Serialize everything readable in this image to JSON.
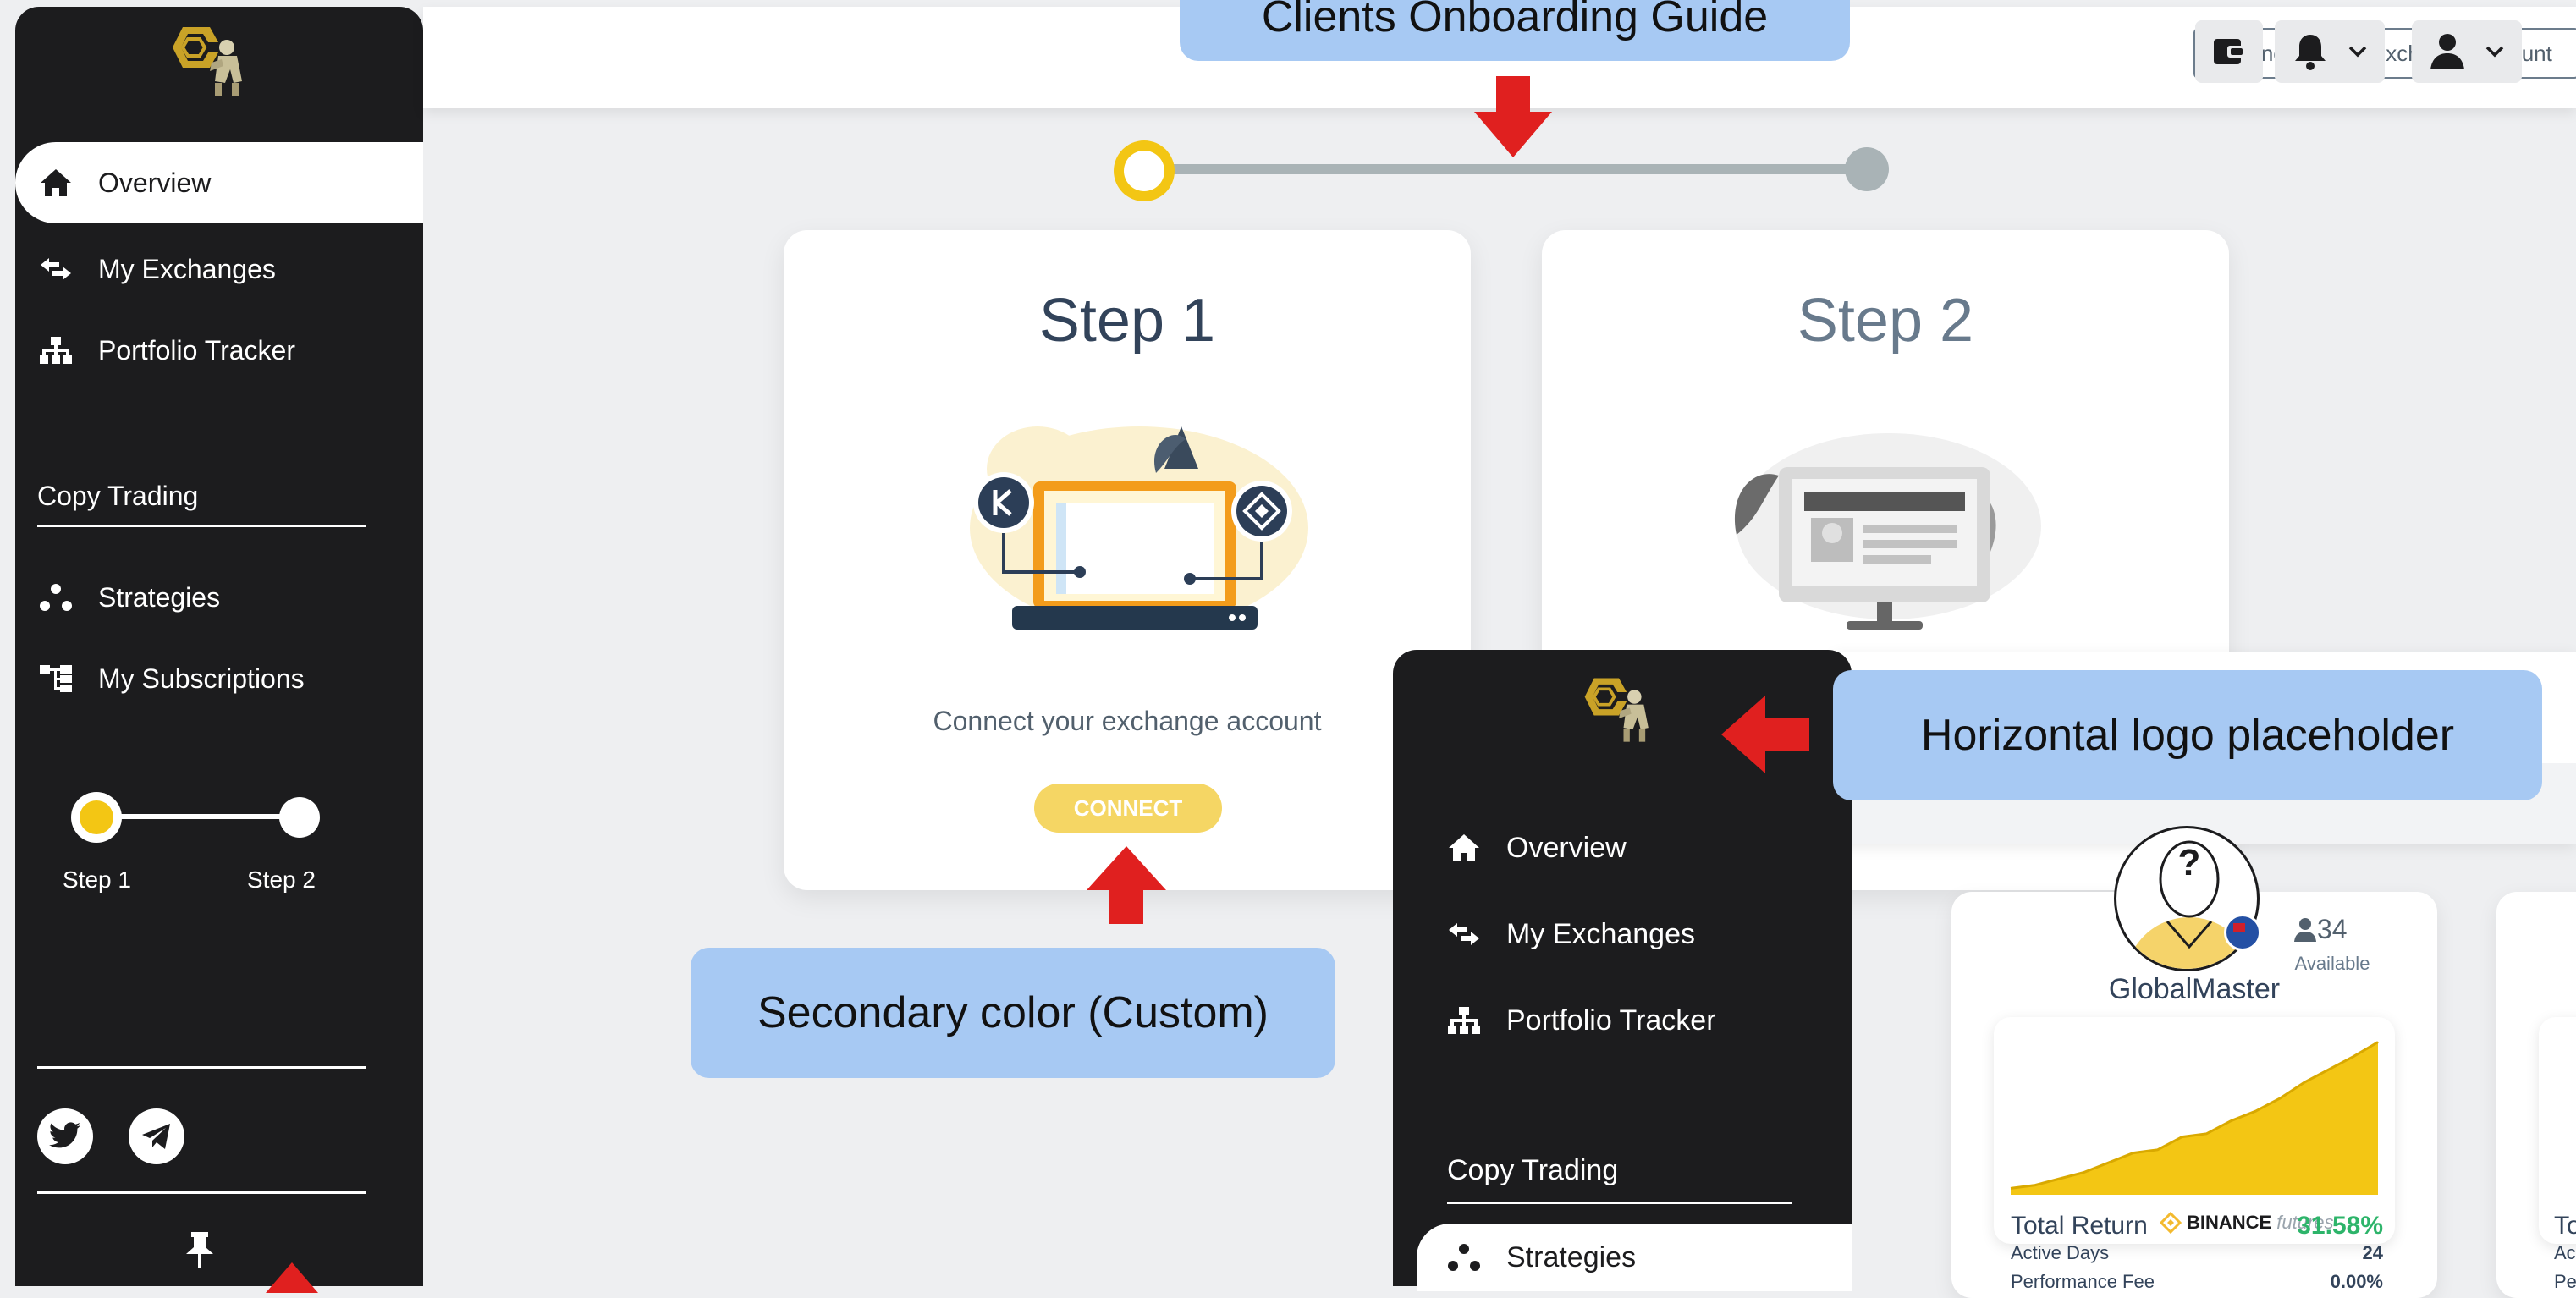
{
  "colors": {
    "sidebar_bg": "#1c1c1e",
    "accent": "#f3c614",
    "callout": "#a7c9f3",
    "arrow": "#e0201f",
    "positive": "#2db46a"
  },
  "sidebar": {
    "items": [
      {
        "label": "Overview",
        "icon": "home-icon",
        "active": true
      },
      {
        "label": "My Exchanges",
        "icon": "exchange-arrows-icon"
      },
      {
        "label": "Portfolio Tracker",
        "icon": "sitemap-icon"
      }
    ],
    "copy_trading_title": "Copy Trading",
    "copy_items": [
      {
        "label": "Strategies",
        "icon": "strategies-dots-icon"
      },
      {
        "label": "My Subscriptions",
        "icon": "subscriptions-icon"
      }
    ],
    "progress_steps": [
      "Step 1",
      "Step 2"
    ],
    "social": [
      "twitter-icon",
      "telegram-icon"
    ]
  },
  "header": {
    "connect_placeholder": "Connect a new exchange account",
    "buttons": [
      "wallet-icon",
      "bell-icon",
      "user-icon"
    ]
  },
  "onboarding": {
    "step1": {
      "title": "Step 1",
      "text": "Connect your exchange account",
      "button": "CONNECT"
    },
    "step2": {
      "title": "Step 2"
    }
  },
  "callouts": {
    "guide": "Clients Onboarding Guide",
    "secondary_color": "Secondary color (Custom)",
    "logo_placeholder": "Horizontal logo placeholder"
  },
  "overlay_sidebar": {
    "items": [
      {
        "label": "Overview",
        "icon": "home-icon"
      },
      {
        "label": "My Exchanges",
        "icon": "exchange-arrows-icon"
      },
      {
        "label": "Portfolio Tracker",
        "icon": "sitemap-icon"
      }
    ],
    "copy_trading_title": "Copy Trading",
    "strategies_label": "Strategies"
  },
  "strategy_card": {
    "name": "GlobalMaster",
    "available_count": "34",
    "available_label": "Available",
    "avatar_glyph": "?",
    "exchange_brand": "BINANCE",
    "exchange_suffix": "futures",
    "total_return_label": "Total Return",
    "total_return_value": "31.58%",
    "active_days_label": "Active Days",
    "active_days_value": "24",
    "performance_fee_label": "Performance Fee",
    "performance_fee_value": "0.00%",
    "chart_series": [
      0.04,
      0.06,
      0.1,
      0.14,
      0.2,
      0.26,
      0.28,
      0.36,
      0.38,
      0.46,
      0.52,
      0.6,
      0.7,
      0.78,
      0.86,
      0.95
    ]
  },
  "partial_card": {
    "to_label": "To",
    "ac_label": "Ac",
    "pe_label": "Pe"
  }
}
